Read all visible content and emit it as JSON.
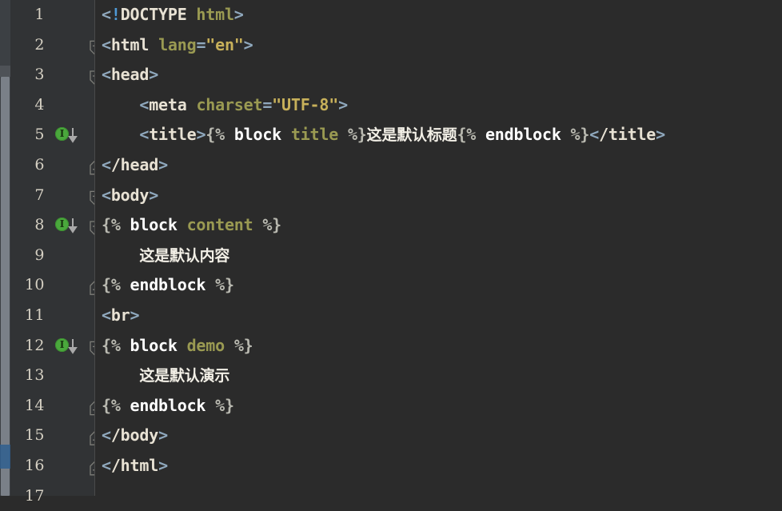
{
  "editor": {
    "theme": "darcula",
    "background_color": "#2b2b2b",
    "gutter_color": "#313335",
    "scrollbar_color": "#7a8088",
    "blue_marker_color": "#2f5f8f"
  },
  "gutter": {
    "icon_name": "green-override-indicator-icon",
    "icon_glyph": "I",
    "icon_color": "#4aa83c",
    "arrow_glyph": "↓",
    "fold_open_name": "fold-marker-open",
    "fold_close_name": "fold-marker-close"
  },
  "lines": [
    {
      "number": "1",
      "has_icon": false,
      "fold": "none",
      "tokens": [
        {
          "t": "<",
          "c": "t-punct"
        },
        {
          "t": "!",
          "c": "t-bang"
        },
        {
          "t": "DOCTYPE",
          "c": "t-doctype"
        },
        {
          "t": " ",
          "c": "t-text"
        },
        {
          "t": "html",
          "c": "t-doctype-name"
        },
        {
          "t": ">",
          "c": "t-punct"
        }
      ],
      "indent": 0,
      "plain": "<!DOCTYPE html>"
    },
    {
      "number": "2",
      "has_icon": false,
      "fold": "open",
      "tokens": [
        {
          "t": "<",
          "c": "t-punct"
        },
        {
          "t": "html",
          "c": "t-tag"
        },
        {
          "t": " ",
          "c": "t-text"
        },
        {
          "t": "lang",
          "c": "t-attr"
        },
        {
          "t": "=",
          "c": "t-punct"
        },
        {
          "t": "\"en\"",
          "c": "t-string"
        },
        {
          "t": ">",
          "c": "t-punct"
        }
      ],
      "indent": 0,
      "plain": "<html lang=\"en\">"
    },
    {
      "number": "3",
      "has_icon": false,
      "fold": "open",
      "tokens": [
        {
          "t": "<",
          "c": "t-punct"
        },
        {
          "t": "head",
          "c": "t-tag"
        },
        {
          "t": ">",
          "c": "t-punct"
        }
      ],
      "indent": 0,
      "plain": "<head>"
    },
    {
      "number": "4",
      "has_icon": false,
      "fold": "none",
      "tokens": [
        {
          "t": "    ",
          "c": "t-text"
        },
        {
          "t": "<",
          "c": "t-punct"
        },
        {
          "t": "meta",
          "c": "t-tag"
        },
        {
          "t": " ",
          "c": "t-text"
        },
        {
          "t": "charset",
          "c": "t-attr"
        },
        {
          "t": "=",
          "c": "t-punct"
        },
        {
          "t": "\"UTF-8\"",
          "c": "t-string"
        },
        {
          "t": ">",
          "c": "t-punct"
        }
      ],
      "indent": 1,
      "plain": "    <meta charset=\"UTF-8\">"
    },
    {
      "number": "5",
      "has_icon": true,
      "fold": "none",
      "tokens": [
        {
          "t": "    ",
          "c": "t-text"
        },
        {
          "t": "<",
          "c": "t-punct"
        },
        {
          "t": "title",
          "c": "t-tag"
        },
        {
          "t": ">",
          "c": "t-punct"
        },
        {
          "t": "{%",
          "c": "t-tplpunct"
        },
        {
          "t": " ",
          "c": "t-text"
        },
        {
          "t": "block",
          "c": "t-tplkw"
        },
        {
          "t": " ",
          "c": "t-text"
        },
        {
          "t": "title",
          "c": "t-tplname"
        },
        {
          "t": " ",
          "c": "t-text"
        },
        {
          "t": "%}",
          "c": "t-tplpunct"
        },
        {
          "t": "这是默认标题",
          "c": "t-text cjk"
        },
        {
          "t": "{%",
          "c": "t-tplpunct"
        },
        {
          "t": " ",
          "c": "t-text"
        },
        {
          "t": "endblock",
          "c": "t-tplkw"
        },
        {
          "t": " ",
          "c": "t-text"
        },
        {
          "t": "%}",
          "c": "t-tplpunct"
        },
        {
          "t": "<",
          "c": "t-punct"
        },
        {
          "t": "/title",
          "c": "t-tag"
        },
        {
          "t": ">",
          "c": "t-punct"
        }
      ],
      "indent": 1,
      "plain": "    <title>{% block title %}这是默认标题{% endblock %}</title>"
    },
    {
      "number": "6",
      "has_icon": false,
      "fold": "close",
      "tokens": [
        {
          "t": "<",
          "c": "t-punct"
        },
        {
          "t": "/head",
          "c": "t-tag"
        },
        {
          "t": ">",
          "c": "t-punct"
        }
      ],
      "indent": 0,
      "plain": "</head>"
    },
    {
      "number": "7",
      "has_icon": false,
      "fold": "open",
      "tokens": [
        {
          "t": "<",
          "c": "t-punct"
        },
        {
          "t": "body",
          "c": "t-tag"
        },
        {
          "t": ">",
          "c": "t-punct"
        }
      ],
      "indent": 0,
      "plain": "<body>"
    },
    {
      "number": "8",
      "has_icon": true,
      "fold": "open",
      "tokens": [
        {
          "t": "{%",
          "c": "t-tplpunct"
        },
        {
          "t": " ",
          "c": "t-text"
        },
        {
          "t": "block",
          "c": "t-tplkw"
        },
        {
          "t": " ",
          "c": "t-text"
        },
        {
          "t": "content",
          "c": "t-tplname"
        },
        {
          "t": " ",
          "c": "t-text"
        },
        {
          "t": "%}",
          "c": "t-tplpunct"
        }
      ],
      "indent": 0,
      "plain": "{% block content %}"
    },
    {
      "number": "9",
      "has_icon": false,
      "fold": "none",
      "tokens": [
        {
          "t": "    ",
          "c": "t-text"
        },
        {
          "t": "这是默认内容",
          "c": "t-text cjk"
        }
      ],
      "indent": 1,
      "plain": "    这是默认内容"
    },
    {
      "number": "10",
      "has_icon": false,
      "fold": "close",
      "tokens": [
        {
          "t": "{%",
          "c": "t-tplpunct"
        },
        {
          "t": " ",
          "c": "t-text"
        },
        {
          "t": "endblock",
          "c": "t-tplkw"
        },
        {
          "t": " ",
          "c": "t-text"
        },
        {
          "t": "%}",
          "c": "t-tplpunct"
        }
      ],
      "indent": 0,
      "plain": "{% endblock %}"
    },
    {
      "number": "11",
      "has_icon": false,
      "fold": "none",
      "tokens": [
        {
          "t": "<",
          "c": "t-punct"
        },
        {
          "t": "br",
          "c": "t-tag"
        },
        {
          "t": ">",
          "c": "t-punct"
        }
      ],
      "indent": 0,
      "plain": "<br>"
    },
    {
      "number": "12",
      "has_icon": true,
      "fold": "open",
      "tokens": [
        {
          "t": "{%",
          "c": "t-tplpunct"
        },
        {
          "t": " ",
          "c": "t-text"
        },
        {
          "t": "block",
          "c": "t-tplkw"
        },
        {
          "t": " ",
          "c": "t-text"
        },
        {
          "t": "demo",
          "c": "t-tplname"
        },
        {
          "t": " ",
          "c": "t-text"
        },
        {
          "t": "%}",
          "c": "t-tplpunct"
        }
      ],
      "indent": 0,
      "plain": "{% block demo %}"
    },
    {
      "number": "13",
      "has_icon": false,
      "fold": "none",
      "tokens": [
        {
          "t": "    ",
          "c": "t-text"
        },
        {
          "t": "这是默认演示",
          "c": "t-text cjk"
        }
      ],
      "indent": 1,
      "plain": "    这是默认演示"
    },
    {
      "number": "14",
      "has_icon": false,
      "fold": "close",
      "tokens": [
        {
          "t": "{%",
          "c": "t-tplpunct"
        },
        {
          "t": " ",
          "c": "t-text"
        },
        {
          "t": "endblock",
          "c": "t-tplkw"
        },
        {
          "t": " ",
          "c": "t-text"
        },
        {
          "t": "%}",
          "c": "t-tplpunct"
        }
      ],
      "indent": 0,
      "plain": "{% endblock %}"
    },
    {
      "number": "15",
      "has_icon": false,
      "fold": "close",
      "tokens": [
        {
          "t": "<",
          "c": "t-punct"
        },
        {
          "t": "/body",
          "c": "t-tag"
        },
        {
          "t": ">",
          "c": "t-punct"
        }
      ],
      "indent": 0,
      "plain": "</body>"
    },
    {
      "number": "16",
      "has_icon": false,
      "fold": "close",
      "tokens": [
        {
          "t": "<",
          "c": "t-punct"
        },
        {
          "t": "/html",
          "c": "t-tag"
        },
        {
          "t": ">",
          "c": "t-punct"
        }
      ],
      "indent": 0,
      "plain": "</html>"
    },
    {
      "number": "17",
      "has_icon": false,
      "fold": "none",
      "tokens": [],
      "indent": 0,
      "plain": ""
    }
  ]
}
